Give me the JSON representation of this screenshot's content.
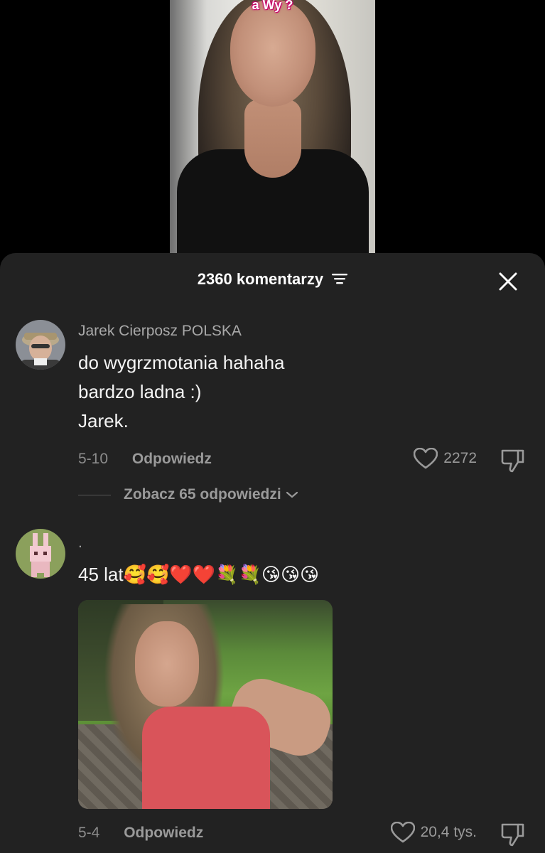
{
  "video": {
    "caption_line1": "",
    "caption_line2": "a Wy ?"
  },
  "comments_panel": {
    "title": "2360 komentarzy",
    "sort_icon": "sort-lines-icon",
    "close_icon": "close-icon"
  },
  "comments": [
    {
      "author": "Jarek Cierposz POLSKA",
      "lines": [
        "do wygrzmotania hahaha",
        "bardzo ladna :)",
        "Jarek."
      ],
      "date": "5-10",
      "reply_label": "Odpowiedz",
      "likes": "2272",
      "view_replies": "Zobacz 65 odpowiedzi"
    },
    {
      "author": ".",
      "text": "45 lat🥰🥰❤️❤️💐💐😘😘😘",
      "date": "5-4",
      "reply_label": "Odpowiedz",
      "likes": "20,4 tys."
    }
  ],
  "colors": {
    "sheet_bg": "#222222",
    "muted_text": "#9a9a9a",
    "caption_outline": "#c8006a"
  }
}
